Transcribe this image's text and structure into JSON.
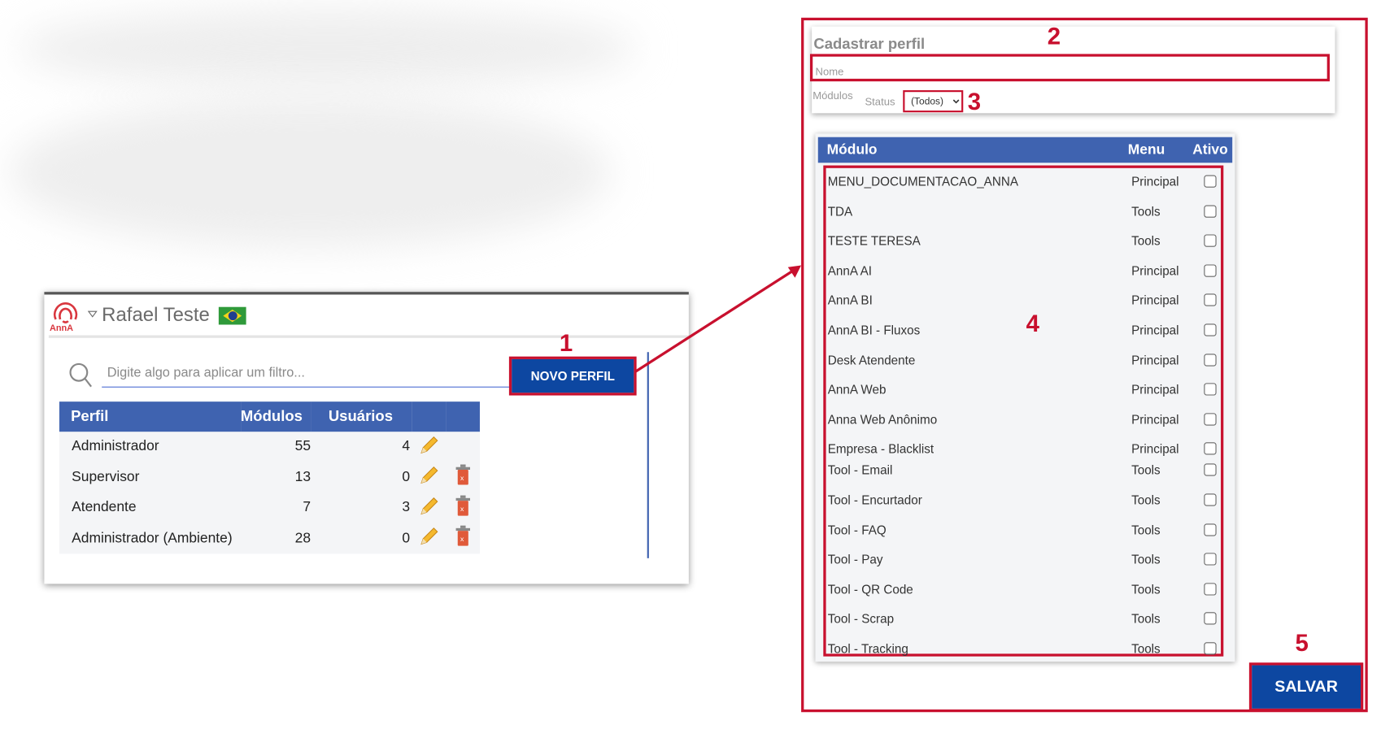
{
  "left_panel": {
    "logo_text": "AnnA",
    "user_name": "Rafael Teste",
    "search_placeholder": "Digite algo para aplicar um filtro...",
    "new_profile_button": "NOVO PERFIL",
    "table": {
      "headers": [
        "Perfil",
        "Módulos",
        "Usuários"
      ],
      "rows": [
        {
          "perfil": "Administrador",
          "modulos": "55",
          "usuarios": "4",
          "deletable": false
        },
        {
          "perfil": "Supervisor",
          "modulos": "13",
          "usuarios": "0",
          "deletable": true
        },
        {
          "perfil": "Atendente",
          "modulos": "7",
          "usuarios": "3",
          "deletable": true
        },
        {
          "perfil": "Administrador (Ambiente)",
          "modulos": "28",
          "usuarios": "0",
          "deletable": true
        }
      ]
    }
  },
  "right_panel": {
    "title": "Cadastrar perfil",
    "name_placeholder": "Nome",
    "modules_label": "Módulos",
    "status_label": "Status",
    "status_value": "(Todos)",
    "table": {
      "headers": [
        "Módulo",
        "Menu",
        "Ativo"
      ],
      "rows": [
        {
          "modulo": "MENU_DOCUMENTACAO_ANNA",
          "menu": "Principal",
          "ativo": false
        },
        {
          "modulo": "TDA",
          "menu": "Tools",
          "ativo": false
        },
        {
          "modulo": "TESTE TERESA",
          "menu": "Tools",
          "ativo": false
        },
        {
          "modulo": "AnnA AI",
          "menu": "Principal",
          "ativo": false
        },
        {
          "modulo": "AnnA BI",
          "menu": "Principal",
          "ativo": false
        },
        {
          "modulo": "AnnA BI - Fluxos",
          "menu": "Principal",
          "ativo": false
        },
        {
          "modulo": "Desk Atendente",
          "menu": "Principal",
          "ativo": false
        },
        {
          "modulo": "AnnA Web",
          "menu": "Principal",
          "ativo": false
        },
        {
          "modulo": "Anna Web Anônimo",
          "menu": "Principal",
          "ativo": false
        },
        {
          "modulo": "Empresa - Blacklist",
          "menu": "Principal",
          "ativo": false
        },
        {
          "modulo": "Tool - Email",
          "menu": "Tools",
          "ativo": false
        },
        {
          "modulo": "Tool - Encurtador",
          "menu": "Tools",
          "ativo": false
        },
        {
          "modulo": "Tool - FAQ",
          "menu": "Tools",
          "ativo": false
        },
        {
          "modulo": "Tool - Pay",
          "menu": "Tools",
          "ativo": false
        },
        {
          "modulo": "Tool - QR Code",
          "menu": "Tools",
          "ativo": false
        },
        {
          "modulo": "Tool - Scrap",
          "menu": "Tools",
          "ativo": false
        },
        {
          "modulo": "Tool - Tracking",
          "menu": "Tools",
          "ativo": false
        }
      ]
    },
    "save_button": "SALVAR"
  },
  "annotations": [
    "1",
    "2",
    "3",
    "4",
    "5"
  ],
  "colors": {
    "primary": "#0d47a1",
    "header": "#3f63b0",
    "highlight": "#c8102e",
    "row_bg": "#f4f5f7"
  }
}
